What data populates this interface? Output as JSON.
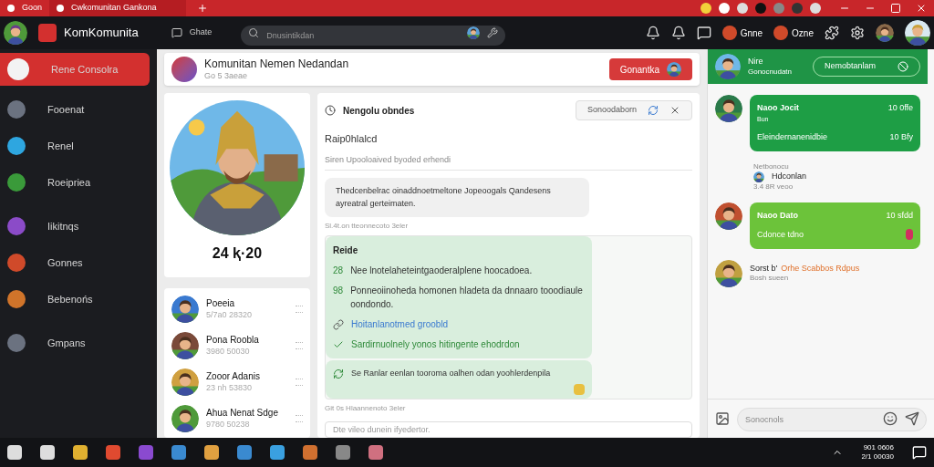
{
  "browser": {
    "tabs": [
      {
        "label": "Goon",
        "selected": false
      },
      {
        "label": "Cwkomunitan Gankona",
        "selected": true
      }
    ]
  },
  "header": {
    "brand": "KomKomunita",
    "button": "Ghate",
    "search": {
      "placeholder": "Dnusintikdan"
    },
    "chips": [
      "Gnne",
      "Ozne"
    ]
  },
  "sidebar": {
    "items": [
      {
        "label": "Rene Consolra",
        "selected": true
      },
      {
        "label": "Fooenat",
        "selected": false
      },
      {
        "label": "Renel",
        "selected": false
      },
      {
        "label": "Roeipriea",
        "selected": false
      },
      {
        "label": "Iikitnqs",
        "selected": false
      },
      {
        "label": "Gonnes",
        "selected": false
      },
      {
        "label": "Bebenońs",
        "selected": false
      },
      {
        "label": "Gmpans",
        "selected": false
      }
    ]
  },
  "community": {
    "title": "Komunitan Nemen Nedandan",
    "subtitle": "Go 5 3aeae",
    "button": "Gonantka"
  },
  "profile": {
    "score": "24 ⱪ·20"
  },
  "friends": [
    {
      "name": "Poeeia",
      "sub": "5/7a0 28320"
    },
    {
      "name": "Pona Roobla",
      "sub": "3980 50030"
    },
    {
      "name": "Zooor Adanis",
      "sub": "23 nh 53830"
    },
    {
      "name": "Ahua Nenat Sdge",
      "sub": "9780 50238"
    }
  ],
  "chat": {
    "title": "Nengolu obndes",
    "button": "Sonoodaborn",
    "heading": "Raip0hlalcd",
    "subtitle": "Siren Upooloaived byoded erhendi",
    "bubble": "Thedcenbelrac oinaddnoetmeltone Jopeoogals Qandesens ayreatral gerteimaten.",
    "meta": "Sl.4t.on tteonnecoto 3eler",
    "reply": {
      "title": "Reide",
      "lines": [
        {
          "kind": "numbered",
          "marker": "28",
          "text": "Nee lnotelaheteintgaoderalplene hoocadoea."
        },
        {
          "kind": "numbered",
          "marker": "98",
          "text": "Ponneoiinoheda homonen hladeta da dnnaaro tooodiaule oondondo."
        },
        {
          "kind": "link",
          "text": "Hoitanlanotmed groobld"
        },
        {
          "kind": "check",
          "text": "Sardirnuolnely yonos hitingente ehodrdon"
        }
      ],
      "footer": "Se Ranlar eenlan tooroma oalhen odan yoohlerdenpila"
    },
    "meta2": "Git 0s Hlaannenoto 3eler",
    "input": {
      "placeholder": "Dte vileo dunein ifyedertor."
    }
  },
  "right": {
    "name": "Nire",
    "status": "Gonocnudatn",
    "button": "Nemobtanlam",
    "messages": [
      {
        "kind": "bubble",
        "name": "Naoo Jocit",
        "sub": "Bun",
        "time": "10 0ffe",
        "text": "Eleindernanenidbie",
        "time2": "10 Bfy",
        "color": "#1e9e45"
      },
      {
        "kind": "note",
        "label": "Netbonocu",
        "name": "Hdconlan",
        "time": "3.4 8R veoo"
      },
      {
        "kind": "bubble",
        "name": "Naoo Dato",
        "time": "10 sfdd",
        "text": "Cdonce tdno",
        "color": "#6cc33a"
      },
      {
        "kind": "mention",
        "name": "Sorst b'",
        "link": "Orhe Scabbos Rdpus",
        "sub": "Bosh sueen"
      }
    ],
    "input": {
      "placeholder": "Sonocnols"
    }
  },
  "taskbar": {
    "clock": [
      "901 0606",
      "2/1 00030"
    ]
  }
}
